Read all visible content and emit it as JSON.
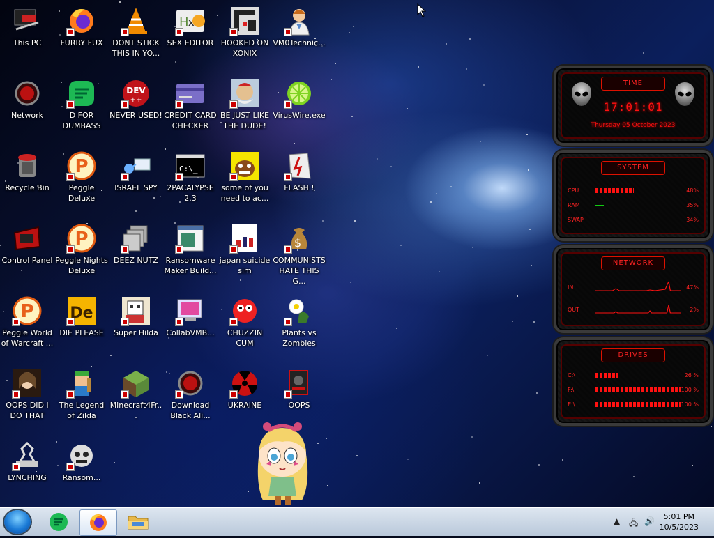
{
  "desktop": {
    "icons": [
      {
        "label": "This PC"
      },
      {
        "label": "FURRY FUX"
      },
      {
        "label": "DONT STICK THIS IN YO..."
      },
      {
        "label": "SEX EDITOR"
      },
      {
        "label": "HOOKED ON XONIX"
      },
      {
        "label": "VM0Technic..."
      },
      {
        "label": "Network"
      },
      {
        "label": "D FOR DUMBASS"
      },
      {
        "label": "NEVER USED!"
      },
      {
        "label": "CREDIT CARD CHECKER"
      },
      {
        "label": "BE JUST LIKE THE DUDE!"
      },
      {
        "label": "VirusWire.exe"
      },
      {
        "label": "Recycle Bin"
      },
      {
        "label": "Peggle Deluxe"
      },
      {
        "label": "ISRAEL SPY"
      },
      {
        "label": "2PACALYPSE 2.3"
      },
      {
        "label": "some of you need to ac..."
      },
      {
        "label": "FLASH !"
      },
      {
        "label": "Control Panel"
      },
      {
        "label": "Peggle Nights Deluxe"
      },
      {
        "label": "DEEZ NUTZ"
      },
      {
        "label": "Ransomware Maker Build..."
      },
      {
        "label": "japan suicide sim"
      },
      {
        "label": "COMMUNISTS HATE THIS G..."
      },
      {
        "label": "Peggle World of Warcraft ..."
      },
      {
        "label": "DIE PLEASE"
      },
      {
        "label": "Super Hilda"
      },
      {
        "label": "CollabVMB..."
      },
      {
        "label": "CHUZZIN CUM"
      },
      {
        "label": "Plants vs Zombies"
      },
      {
        "label": "OOPS DID I DO THAT"
      },
      {
        "label": "The Legend of Zilda"
      },
      {
        "label": "Minecraft4Fr..."
      },
      {
        "label": "Download Black Ali..."
      },
      {
        "label": "UKRAINE"
      },
      {
        "label": "OOPS"
      },
      {
        "label": "LYNCHING"
      },
      {
        "label": "Ransom..."
      }
    ],
    "icon_art": {
      "dev_text": "DEV",
      "dev_sub": "++",
      "de_text": "De",
      "cmd_text": "C:\\_",
      "p_text": "P"
    }
  },
  "widget": {
    "time": {
      "title": "TIME",
      "value": "17:01:01",
      "date": "Thursday 05 October 2023"
    },
    "system": {
      "title": "SYSTEM",
      "rows": [
        {
          "key": "CPU",
          "value": "48%",
          "level": 0.45
        },
        {
          "key": "RAM",
          "value": "35%",
          "level": 0.1
        },
        {
          "key": "SWAP",
          "value": "34%",
          "level": 0.32
        }
      ]
    },
    "network": {
      "title": "NETWORK",
      "rows": [
        {
          "key": "IN",
          "value": "47%"
        },
        {
          "key": "OUT",
          "value": "2%"
        }
      ]
    },
    "drives": {
      "title": "DRIVES",
      "rows": [
        {
          "key": "C:\\",
          "value": "26 %",
          "level": 0.26
        },
        {
          "key": "F:\\",
          "value": "100 %",
          "level": 1.0
        },
        {
          "key": "E:\\",
          "value": "100 %",
          "level": 1.0
        }
      ]
    }
  },
  "taskbar": {
    "clock_time": "5:01 PM",
    "clock_date": "10/5/2023"
  },
  "colors": {
    "accent_red": "#ff1a1a",
    "taskbar": "#c9d6e6"
  }
}
